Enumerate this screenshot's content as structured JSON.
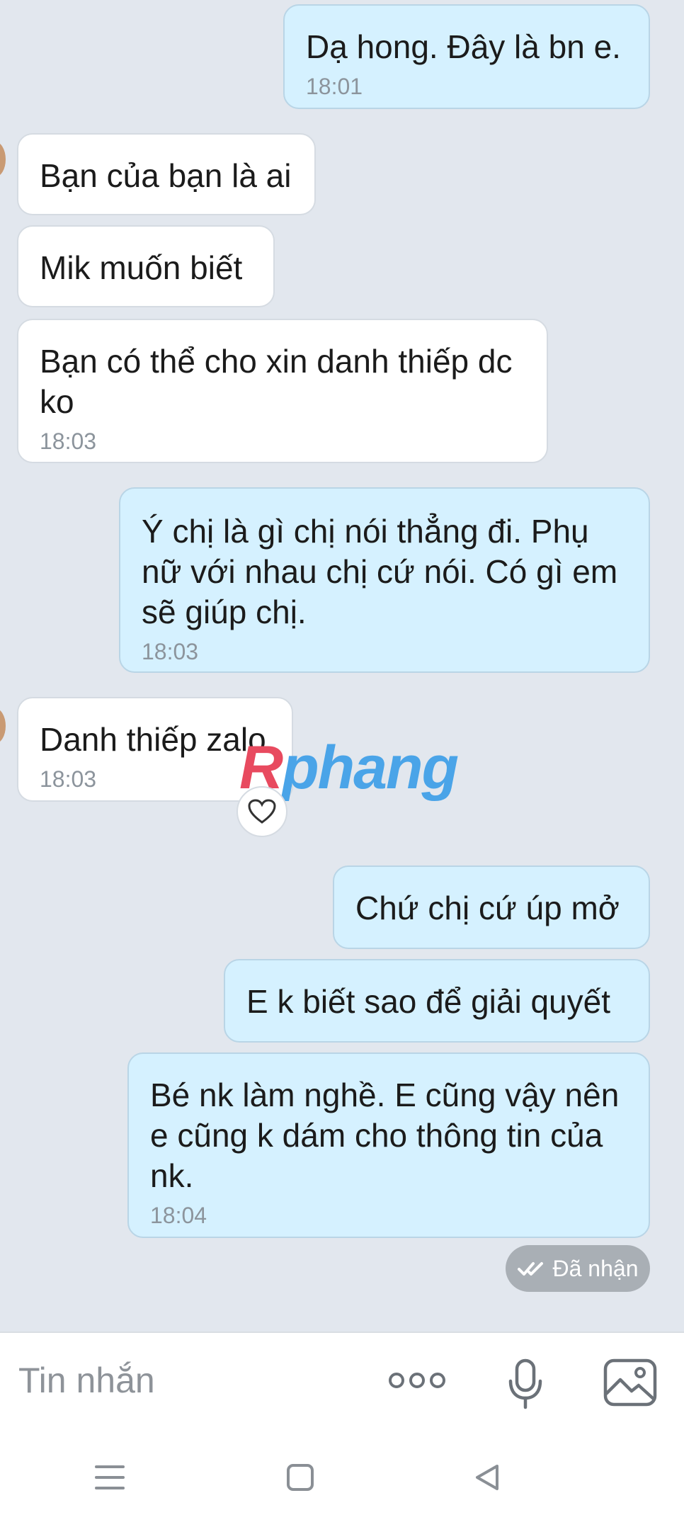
{
  "messages": [
    {
      "dir": "out",
      "text": "Dạ hong. Đây là bn e.",
      "time": "18:01"
    },
    {
      "dir": "in",
      "text": "Bạn của bạn là ai",
      "time": ""
    },
    {
      "dir": "in",
      "text": "Mik muốn biết",
      "time": ""
    },
    {
      "dir": "in",
      "text": "Bạn có thể cho xin danh thiếp dc ko",
      "time": "18:03"
    },
    {
      "dir": "out",
      "text": "Ý chị là gì chị nói thẳng đi. Phụ nữ với nhau chị cứ nói. Có gì em sẽ giúp chị.",
      "time": "18:03"
    },
    {
      "dir": "in",
      "text": "Danh thiếp zalo",
      "time": "18:03"
    },
    {
      "dir": "out",
      "text": "Chứ chị cứ úp mở",
      "time": ""
    },
    {
      "dir": "out",
      "text": "E k biết sao để giải quyết",
      "time": ""
    },
    {
      "dir": "out",
      "text": "Bé nk làm nghề. E cũng vậy nên e cũng k dám cho thông tin của nk.",
      "time": "18:04"
    }
  ],
  "watermark": "Rphang",
  "receipt": "Đã nhận",
  "input": {
    "placeholder": "Tin nhắn"
  },
  "icons": {
    "more": "more-dots-icon",
    "mic": "microphone-icon",
    "image": "image-icon",
    "reaction": "heart-icon"
  },
  "colors": {
    "incoming": "#ffffff",
    "outgoing": "#d5f1ff",
    "accent": "#1a8cff"
  }
}
